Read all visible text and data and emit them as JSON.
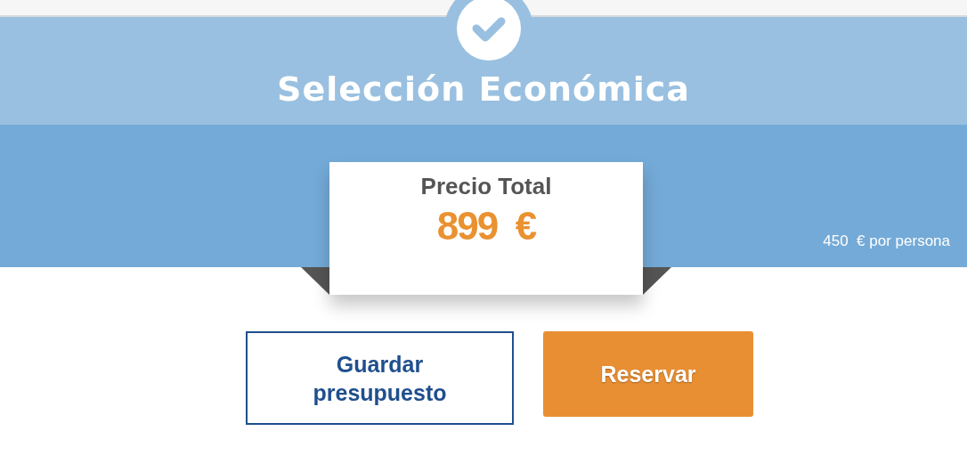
{
  "header": {
    "title": "Selección Económica"
  },
  "price": {
    "label": "Precio Total",
    "amount": "899",
    "currency": "€",
    "per_person": "450  € por persona"
  },
  "buttons": [
    {
      "label": "Guardar presupuesto",
      "kind": "secondary"
    },
    {
      "label": "Reservar",
      "kind": "primary"
    }
  ]
}
